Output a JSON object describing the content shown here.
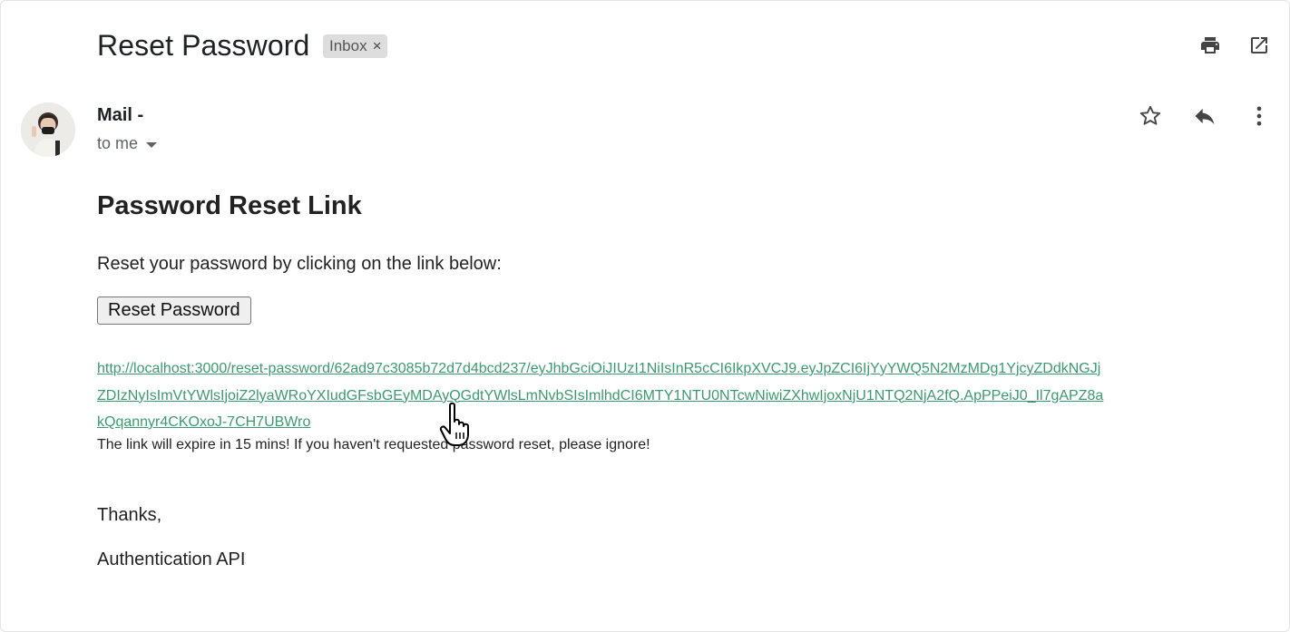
{
  "email": {
    "subject": "Reset Password",
    "label": "Inbox",
    "label_remove": "×"
  },
  "toolbar": {
    "print_icon": "print-icon",
    "open_icon": "open-in-new-window-icon"
  },
  "sender": {
    "name": "Mail -",
    "recipient": "to me",
    "avatar": "avatar-photo"
  },
  "actions": {
    "star_icon": "star-icon",
    "reply_icon": "reply-icon",
    "more_icon": "more-vertical-icon"
  },
  "body": {
    "heading": "Password Reset Link",
    "intro": "Reset your password by clicking on the link below:",
    "button_label": "Reset Password",
    "link": "http://localhost:3000/reset-password/62ad97c3085b72d7d4bcd237/eyJhbGciOiJIUzI1NiIsInR5cCI6IkpXVCJ9.eyJpZCI6IjYyYWQ5N2MzMDg1YjcyZDdkNGJjZDIzNyIsImVtYWlsIjoiZ2lyaWRoYXIudGFsbGEyMDAyQGdtYWlsLmNvbSIsImlhdCI6MTY1NTU0NTcwNiwiZXhwIjoxNjU1NTQ2NjA2fQ.ApPPeiJ0_Il7gAPZ8akQqannyr4CKOxoJ-7CH7UBWro",
    "expire_note": "The link will expire in 15 mins! If you haven't requested password reset, please ignore!",
    "thanks": "Thanks,",
    "signature": "Authentication API"
  },
  "colors": {
    "link": "#3d9a70",
    "chip_bg": "#dddddd",
    "icon": "#5f6368"
  }
}
